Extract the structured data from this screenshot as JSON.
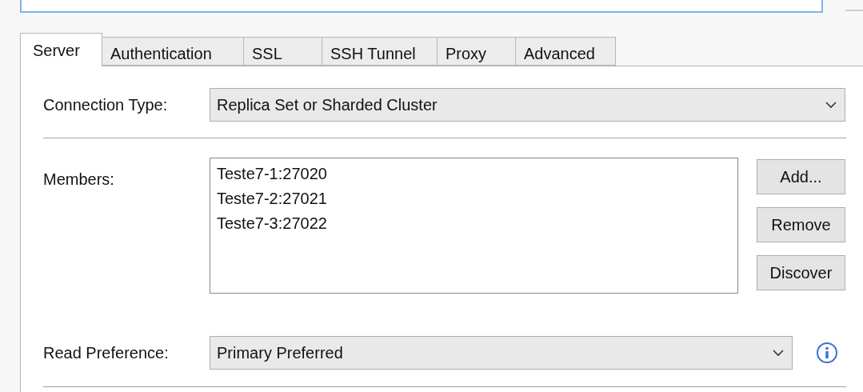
{
  "tabs": [
    {
      "label": "Server",
      "selected": true
    },
    {
      "label": "Authentication",
      "selected": false
    },
    {
      "label": "SSL",
      "selected": false
    },
    {
      "label": "SSH Tunnel",
      "selected": false
    },
    {
      "label": "Proxy",
      "selected": false
    },
    {
      "label": "Advanced",
      "selected": false
    }
  ],
  "connection_type": {
    "label": "Connection Type:",
    "value": "Replica Set or Sharded Cluster"
  },
  "members": {
    "label": "Members:",
    "items": [
      "Teste7-1:27020",
      "Teste7-2:27021",
      "Teste7-3:27022"
    ],
    "buttons": [
      "Add...",
      "Remove",
      "Discover"
    ]
  },
  "read_preference": {
    "label": "Read Preference:",
    "value": "Primary Preferred"
  }
}
